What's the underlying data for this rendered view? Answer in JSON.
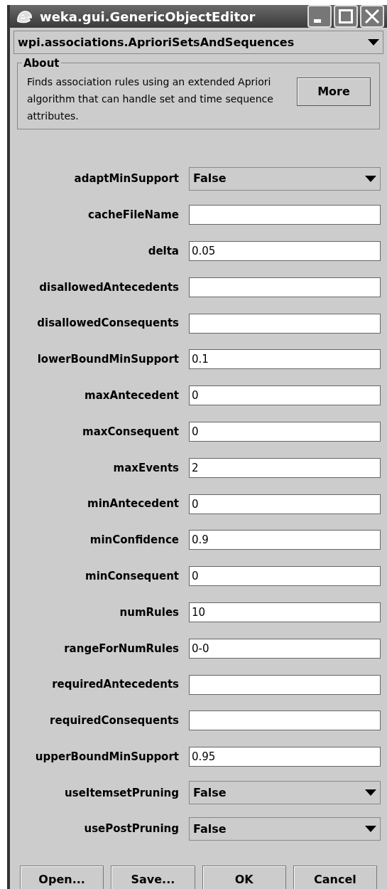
{
  "window": {
    "title": "weka.gui.GenericObjectEditor"
  },
  "class_selector": {
    "value": "wpi.associations.AprioriSetsAndSequences"
  },
  "about": {
    "title": "About",
    "text": "Finds association rules using an extended Apriori algorithm that can handle set and time sequence attributes.",
    "button": "More"
  },
  "properties": [
    {
      "label": "adaptMinSupport",
      "kind": "choice",
      "value": "False"
    },
    {
      "label": "cacheFileName",
      "kind": "text"
    },
    {
      "label": "delta",
      "kind": "text",
      "value": "0.05"
    },
    {
      "label": "disallowedAntecedents",
      "kind": "text"
    },
    {
      "label": "disallowedConsequents",
      "kind": "text"
    },
    {
      "label": "lowerBoundMinSupport",
      "kind": "text",
      "value": "0.1"
    },
    {
      "label": "maxAntecedent",
      "kind": "text",
      "value": "0"
    },
    {
      "label": "maxConsequent",
      "kind": "text",
      "value": "0"
    },
    {
      "label": "maxEvents",
      "kind": "text",
      "value": "2"
    },
    {
      "label": "minAntecedent",
      "kind": "text",
      "value": "0"
    },
    {
      "label": "minConfidence",
      "kind": "text",
      "value": "0.9"
    },
    {
      "label": "minConsequent",
      "kind": "text",
      "value": "0"
    },
    {
      "label": "numRules",
      "kind": "text",
      "value": "10"
    },
    {
      "label": "rangeForNumRules",
      "kind": "text",
      "value": "0-0"
    },
    {
      "label": "requiredAntecedents",
      "kind": "text"
    },
    {
      "label": "requiredConsequents",
      "kind": "text"
    },
    {
      "label": "upperBoundMinSupport",
      "kind": "text",
      "value": "0.95"
    },
    {
      "label": "useItemsetPruning",
      "kind": "choice",
      "value": "False"
    },
    {
      "label": "usePostPruning",
      "kind": "choice",
      "value": "False"
    }
  ],
  "buttons": [
    "Open...",
    "Save...",
    "OK",
    "Cancel"
  ]
}
